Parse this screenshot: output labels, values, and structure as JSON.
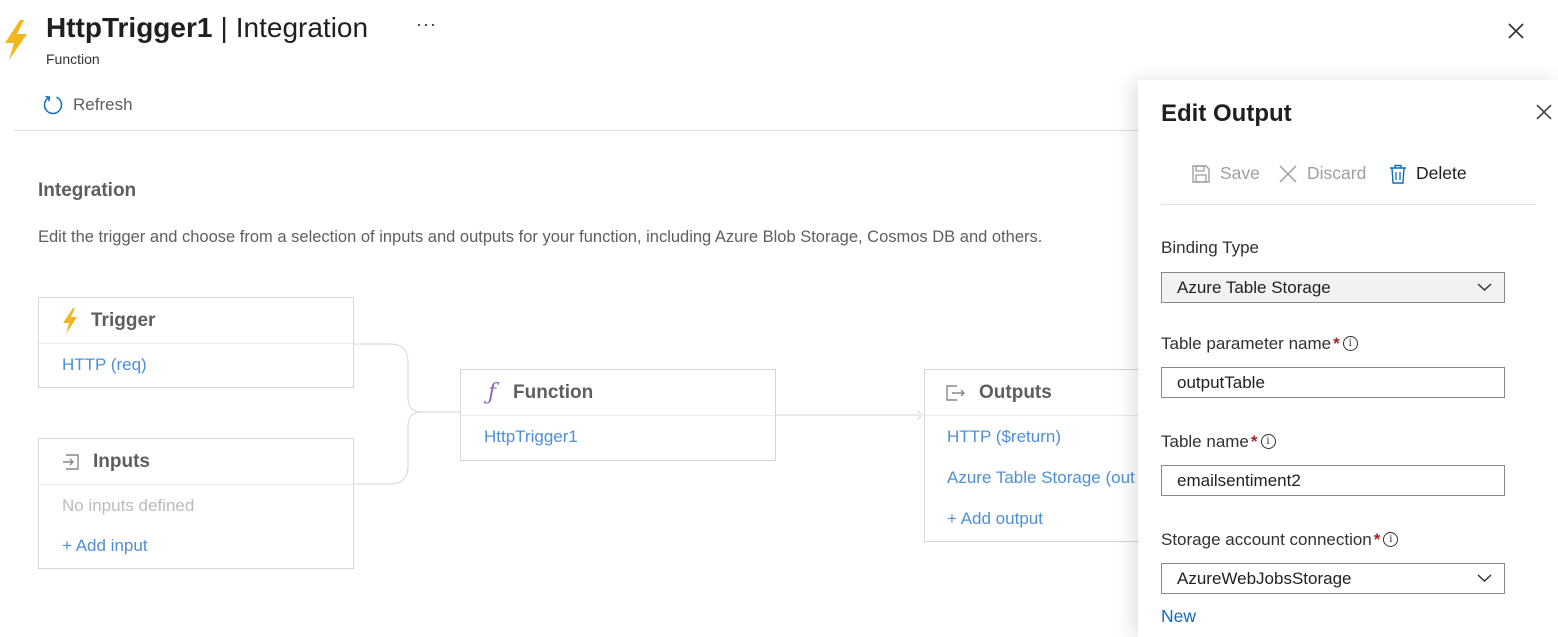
{
  "header": {
    "title": "HttpTrigger1",
    "separator": "|",
    "section": "Integration",
    "subtitle": "Function",
    "more": "···"
  },
  "toolbar": {
    "refresh_label": "Refresh"
  },
  "main": {
    "heading": "Integration",
    "description": "Edit the trigger and choose from a selection of inputs and outputs for your function, including Azure Blob Storage, Cosmos DB and others."
  },
  "trigger_card": {
    "title": "Trigger",
    "item": "HTTP (req)"
  },
  "inputs_card": {
    "title": "Inputs",
    "empty": "No inputs defined",
    "add": "+ Add input"
  },
  "function_card": {
    "title": "Function",
    "item": "HttpTrigger1"
  },
  "outputs_card": {
    "title": "Outputs",
    "items": [
      "HTTP ($return)",
      "Azure Table Storage (out"
    ],
    "add": "+ Add output"
  },
  "panel": {
    "title": "Edit Output",
    "save": "Save",
    "discard": "Discard",
    "delete": "Delete",
    "binding_type_label": "Binding Type",
    "binding_type_value": "Azure Table Storage",
    "param_label": "Table parameter name",
    "param_value": "outputTable",
    "table_label": "Table name",
    "table_value": "emailsentiment2",
    "storage_label": "Storage account connection",
    "storage_value": "AzureWebJobsStorage",
    "new_link": "New",
    "required_mark": "*",
    "info_mark": "i"
  },
  "colors": {
    "link": "#4f8fd8",
    "accent": "#0f6cbd",
    "bolt": "#f2b71f",
    "required": "#a4262c",
    "muted": "#bdbbb9"
  },
  "icons": [
    "lightning-icon",
    "refresh-icon",
    "close-icon",
    "input-icon",
    "function-icon",
    "output-icon",
    "save-icon",
    "discard-icon",
    "delete-icon",
    "chevron-down-icon",
    "info-icon"
  ]
}
